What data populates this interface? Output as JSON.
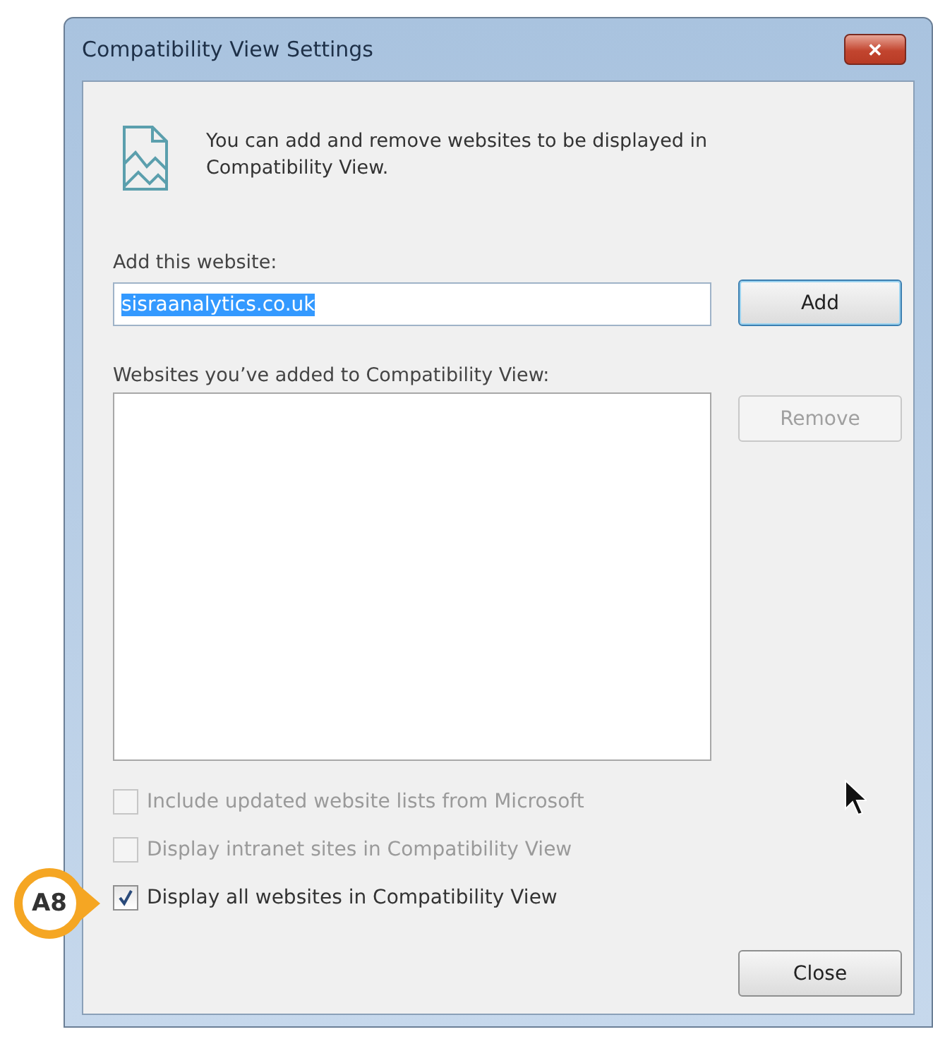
{
  "window": {
    "title": "Compatibility View Settings",
    "close": "✕"
  },
  "intro": "You can add and remove websites to be displayed in Compatibility View.",
  "add_website": {
    "label": "Add this website:",
    "value": "sisraanalytics.co.uk",
    "selected": true,
    "button": {
      "label": "Add",
      "disabled": false,
      "default": true
    }
  },
  "websites_list": {
    "label": "Websites you’ve added to Compatibility View:",
    "button": {
      "label": "Remove",
      "disabled": true,
      "default": false
    }
  },
  "checkboxes": [
    {
      "label": "Include updated website lists from Microsoft",
      "checked": false,
      "disabled": true
    },
    {
      "label": "Display intranet sites in Compatibility View",
      "checked": false,
      "disabled": true
    },
    {
      "label": "Display all websites in Compatibility View",
      "checked": true,
      "disabled": false
    }
  ],
  "close_button": {
    "label": "Close",
    "disabled": false,
    "default": false
  },
  "callout": {
    "label": "A8"
  }
}
